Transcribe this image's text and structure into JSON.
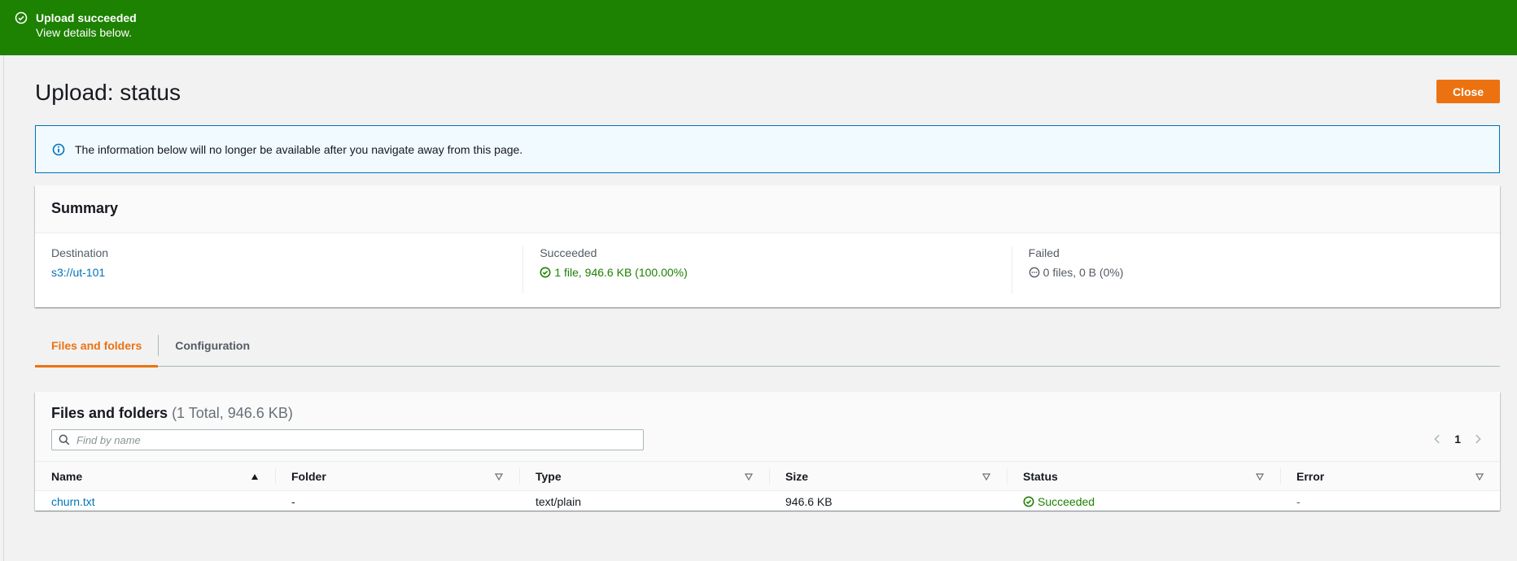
{
  "flash": {
    "title": "Upload succeeded",
    "message": "View details below."
  },
  "page": {
    "title": "Upload: status",
    "close_label": "Close"
  },
  "info": {
    "message": "The information below will no longer be available after you navigate away from this page."
  },
  "summary": {
    "title": "Summary",
    "destination_label": "Destination",
    "destination_value": "s3://ut-101",
    "succeeded_label": "Succeeded",
    "succeeded_value": "1 file, 946.6 KB (100.00%)",
    "failed_label": "Failed",
    "failed_value": "0 files, 0 B (0%)"
  },
  "tabs": [
    {
      "label": "Files and folders",
      "active": true
    },
    {
      "label": "Configuration",
      "active": false
    }
  ],
  "files": {
    "title": "Files and folders",
    "count": "(1 Total, 946.6 KB)",
    "search_placeholder": "Find by name",
    "page": "1",
    "columns": [
      "Name",
      "Folder",
      "Type",
      "Size",
      "Status",
      "Error"
    ],
    "rows": [
      {
        "name": "churn.txt",
        "folder": "-",
        "type": "text/plain",
        "size": "946.6 KB",
        "status": "Succeeded",
        "error": "-"
      }
    ]
  },
  "colors": {
    "success": "#1d8102",
    "accent": "#ec7211",
    "link": "#0073bb",
    "info_border": "#0073bb"
  }
}
